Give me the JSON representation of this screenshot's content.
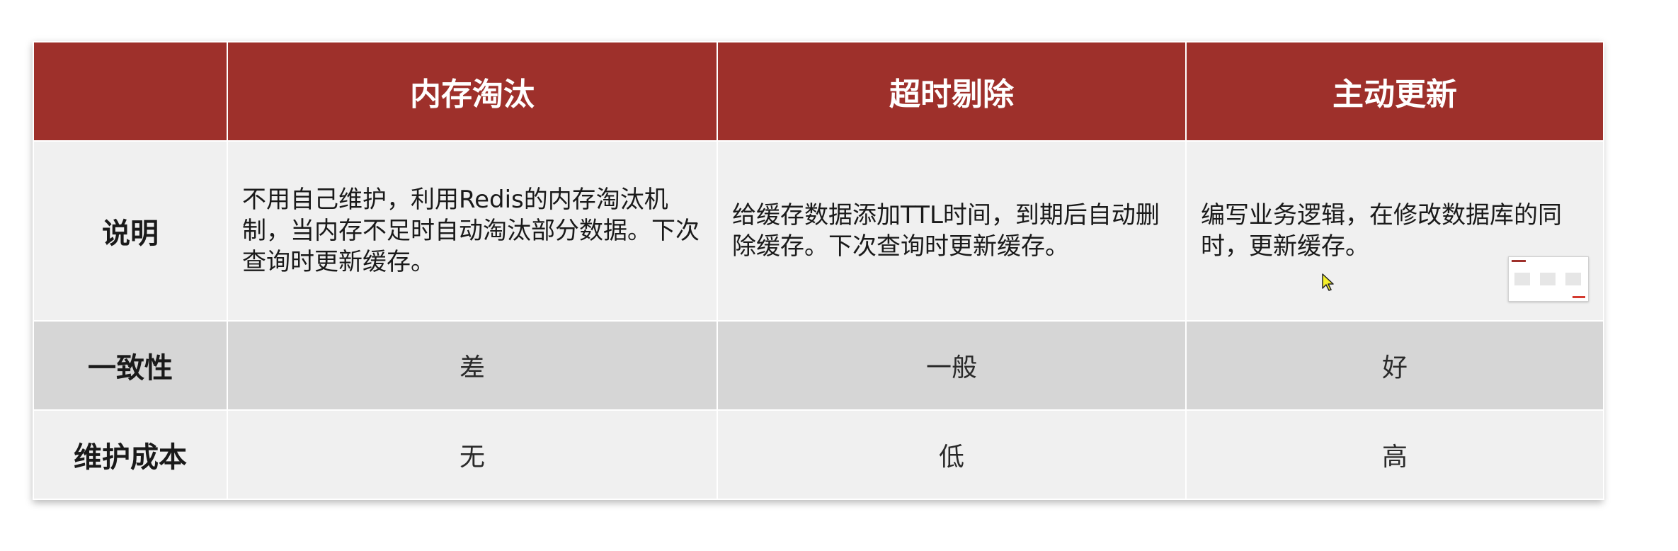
{
  "table": {
    "headers": [
      "",
      "内存淘汰",
      "超时剔除",
      "主动更新"
    ],
    "rows": [
      {
        "label": "说明",
        "cells": [
          "不用自己维护，利用Redis的内存淘汰机制，当内存不足时自动淘汰部分数据。下次查询时更新缓存。",
          "给缓存数据添加TTL时间，到期后自动删除缓存。下次查询时更新缓存。",
          "编写业务逻辑，在修改数据库的同时，更新缓存。"
        ]
      },
      {
        "label": "一致性",
        "cells": [
          "差",
          "一般",
          "好"
        ]
      },
      {
        "label": "维护成本",
        "cells": [
          "无",
          "低",
          "高"
        ]
      }
    ]
  },
  "colors": {
    "header_bg": "#9e302b",
    "header_text": "#ffffff",
    "row_light": "#f0f0f0",
    "row_dark": "#d6d6d6"
  },
  "icons": [
    "mouse-cursor-icon",
    "slide-thumbnail"
  ]
}
